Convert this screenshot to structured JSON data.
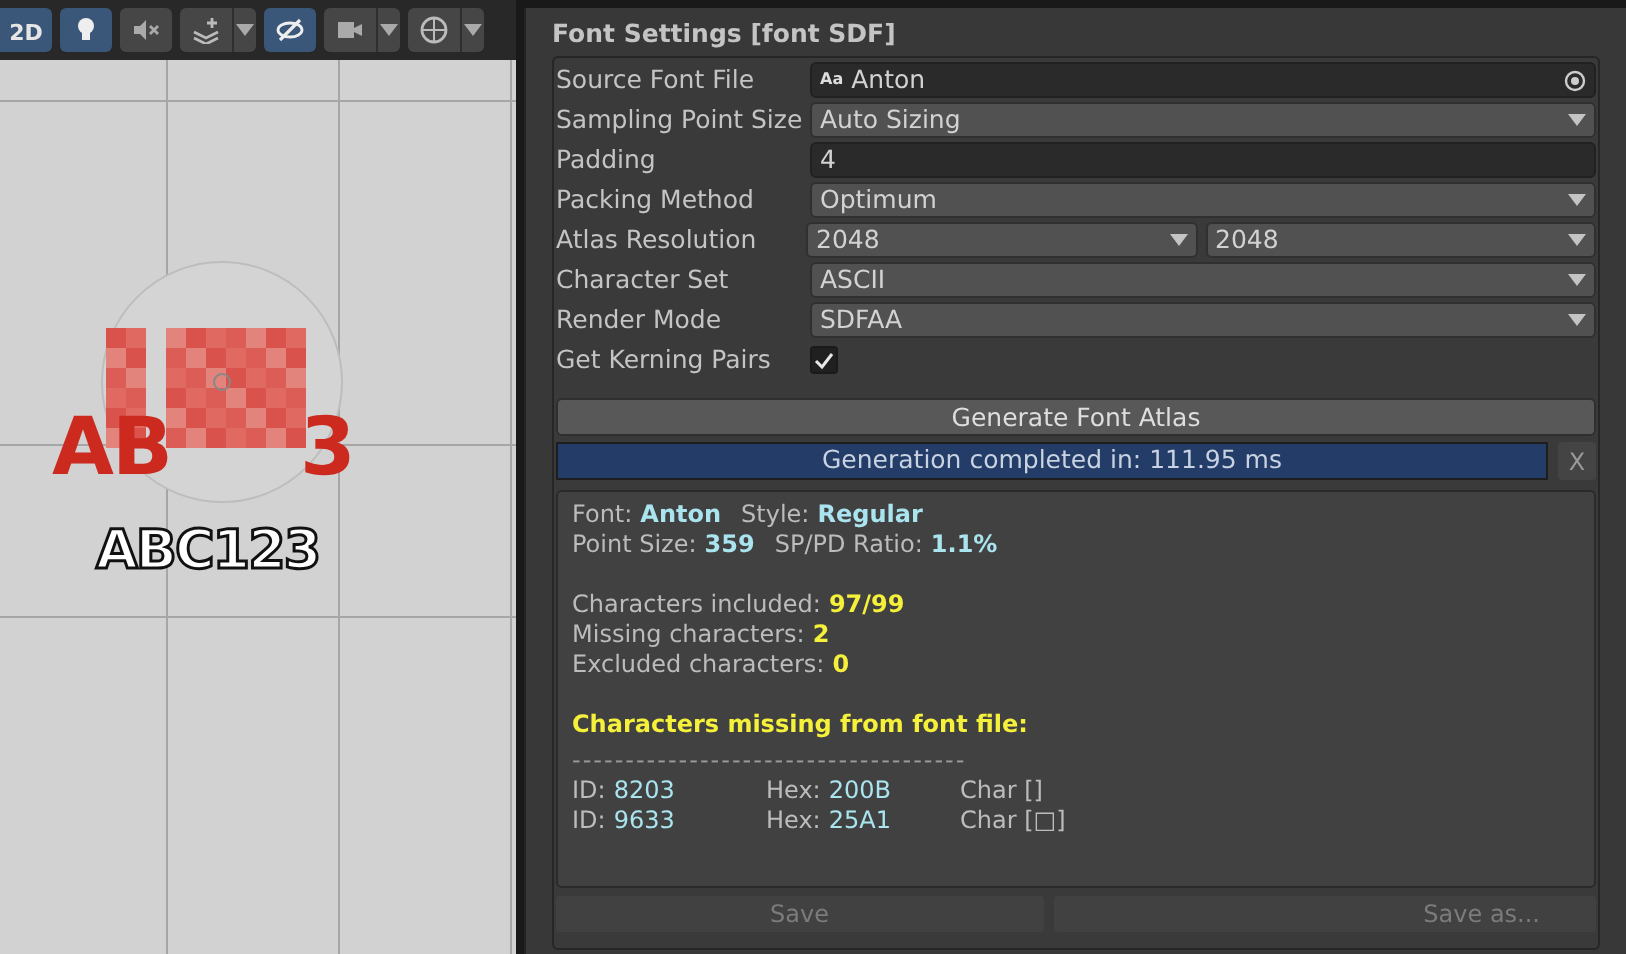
{
  "toolbar": [
    {
      "kind": "text",
      "label": "2D",
      "selected": true
    },
    {
      "kind": "bulb",
      "selected": true
    },
    {
      "kind": "mute",
      "selected": false
    },
    {
      "kind": "layers",
      "selected": false,
      "dropdown": true
    },
    {
      "kind": "eye",
      "selected": true
    },
    {
      "kind": "camera",
      "selected": false,
      "dropdown": true
    },
    {
      "kind": "gizmo",
      "selected": false,
      "dropdown": true
    }
  ],
  "scene": {
    "red_text": [
      "AB",
      "3"
    ],
    "outlined_text": "ABC123"
  },
  "panel": {
    "title": "Font Settings [font SDF]",
    "fields": [
      {
        "kind": "object",
        "label": "Source Font File",
        "icon_text": "Aa",
        "value": "Anton"
      },
      {
        "kind": "dropdown",
        "label": "Sampling Point Size",
        "value": "Auto Sizing"
      },
      {
        "kind": "text",
        "label": "Padding",
        "value": "4"
      },
      {
        "kind": "dropdown",
        "label": "Packing Method",
        "value": "Optimum"
      },
      {
        "kind": "dual",
        "label": "Atlas Resolution",
        "values": [
          "2048",
          "2048"
        ]
      },
      {
        "kind": "dropdown",
        "label": "Character Set",
        "value": "ASCII"
      },
      {
        "kind": "dropdown",
        "label": "Render Mode",
        "value": "SDFAA"
      },
      {
        "kind": "checkbox",
        "label": "Get Kerning Pairs",
        "checked": true
      }
    ],
    "generate_button": "Generate Font Atlas",
    "progress": {
      "label": "Generation completed in: 111.95 ms",
      "level": 1,
      "close": "X"
    },
    "info_groups": [
      [
        [
          {
            "label": "Font:",
            "value": "Anton",
            "color": "#a9e4ef"
          },
          {
            "label": "Style:",
            "value": "Regular",
            "color": "#a9e4ef"
          }
        ],
        [
          {
            "label": "Point Size:",
            "value": "359",
            "color": "#a9e4ef"
          },
          {
            "label": "SP/PD Ratio:",
            "value": "1.1%",
            "color": "#a9e4ef"
          }
        ]
      ],
      [
        [
          {
            "label": "Characters included:",
            "value": "97/99",
            "color": "#f5f03a"
          }
        ],
        [
          {
            "label": "Missing characters:",
            "value": "2",
            "color": "#f5f03a"
          }
        ],
        [
          {
            "label": "Excluded characters:",
            "value": "0",
            "color": "#f5f03a"
          }
        ]
      ]
    ],
    "missing_heading": "Characters missing from font file:",
    "separator": "-------------------------------------",
    "missing": [
      {
        "id_label": "ID:",
        "id": "8203",
        "hex_label": "Hex:",
        "hex": "200B",
        "char": "Char []"
      },
      {
        "id_label": "ID:",
        "id": "9633",
        "hex_label": "Hex:",
        "hex": "25A1",
        "char": "Char [□]"
      }
    ],
    "footer_buttons": [
      {
        "label": "Save",
        "disabled": true
      },
      {
        "label": "Save as...",
        "disabled": true
      }
    ]
  }
}
